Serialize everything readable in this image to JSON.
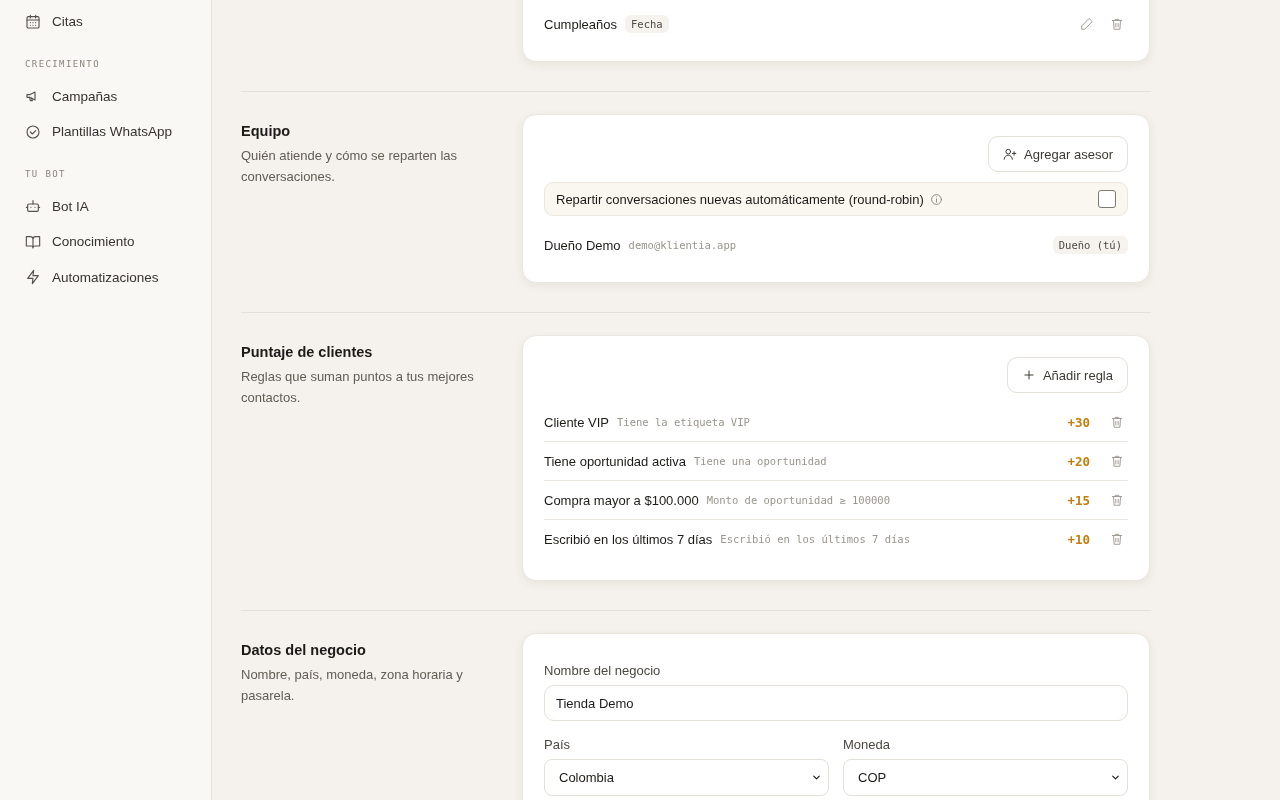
{
  "sidebar": {
    "groups": [
      {
        "items": [
          {
            "label": "Citas"
          }
        ]
      },
      {
        "label": "CRECIMIENTO",
        "items": [
          {
            "label": "Campañas"
          },
          {
            "label": "Plantillas WhatsApp"
          }
        ]
      },
      {
        "label": "TU BOT",
        "items": [
          {
            "label": "Bot IA"
          },
          {
            "label": "Conocimiento"
          },
          {
            "label": "Automatizaciones"
          }
        ]
      }
    ]
  },
  "sections": [
    {
      "kind": "fields",
      "fields": [
        {
          "name": "Cumpleaños",
          "type": "Fecha"
        }
      ]
    },
    {
      "kind": "team",
      "title": "Equipo",
      "description": "Quién atiende y cómo se reparten las conversaciones.",
      "button": "Agregar asesor",
      "toggle": {
        "label": "Repartir conversaciones nuevas automáticamente (round-robin)",
        "checked": false
      },
      "members": [
        {
          "name": "Dueño Demo",
          "email": "demo@klientia.app",
          "role": "Dueño (tú)"
        }
      ]
    },
    {
      "kind": "scoring",
      "title": "Puntaje de clientes",
      "description": "Reglas que suman puntos a tus mejores contactos.",
      "button": "Añadir regla",
      "rules": [
        {
          "name": "Cliente VIP",
          "condition": "Tiene la etiqueta VIP",
          "points": "+30"
        },
        {
          "name": "Tiene oportunidad activa",
          "condition": "Tiene una oportunidad",
          "points": "+20"
        },
        {
          "name": "Compra mayor a $100.000",
          "condition": "Monto de oportunidad ≥ 100000",
          "points": "+15"
        },
        {
          "name": "Escribió en los últimos 7 días",
          "condition": "Escribió en los últimos 7 días",
          "points": "+10"
        }
      ]
    },
    {
      "kind": "business",
      "title": "Datos del negocio",
      "description": "Nombre, país, moneda, zona horaria y pasarela.",
      "name_field": {
        "label": "Nombre del negocio",
        "value": "Tienda Demo"
      },
      "selects": [
        {
          "label": "País",
          "value": "Colombia"
        },
        {
          "label": "Moneda",
          "value": "COP"
        }
      ]
    }
  ]
}
